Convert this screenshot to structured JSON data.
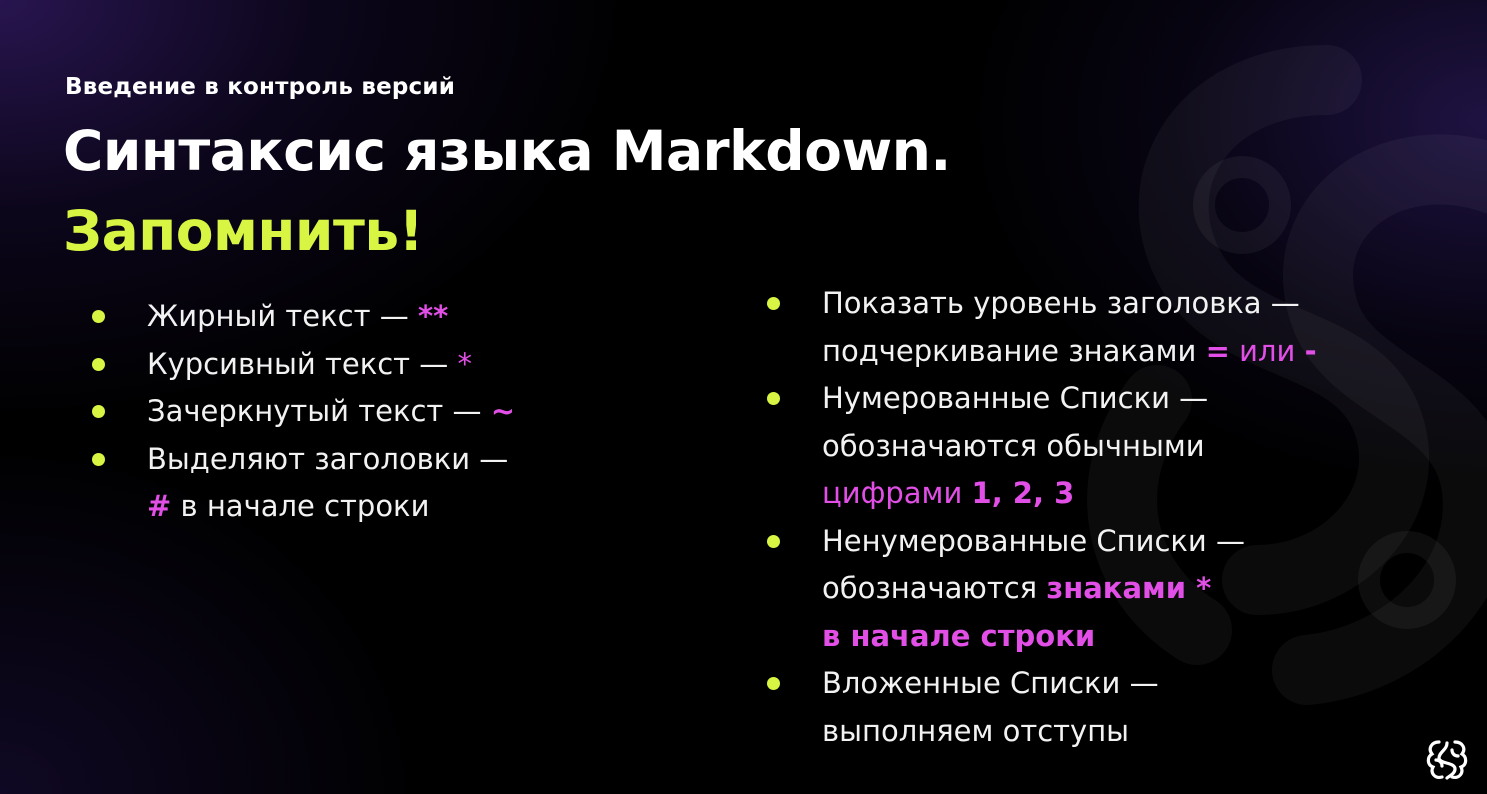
{
  "header": {
    "subtitle": "Введение в контроль версий",
    "title_main": "Синтаксис языка Markdown.",
    "title_accent": "Запомнить!"
  },
  "left_list": [
    {
      "text": "Жирный текст — ",
      "marker": "**"
    },
    {
      "text": "Курсивный текст — ",
      "marker": "*"
    },
    {
      "text": "Зачеркнутый текст — ",
      "marker": "~"
    },
    {
      "line1": "Выделяют заголовки —",
      "marker": "#",
      "line2": " в начале строки"
    }
  ],
  "right_list": [
    {
      "line1": "Показать уровень заголовка —",
      "line2": "подчеркивание знаками ",
      "marker1": "=",
      "sep": " или ",
      "marker2": "-"
    },
    {
      "line1": "Нумерованные Списки —",
      "line2": "обозначаются обычными",
      "line3_word": "цифрами ",
      "line3_digits": "1, 2, 3"
    },
    {
      "line1": "Ненумерованные Списки —",
      "line2": "обозначаются ",
      "line2_accent": "знаками *",
      "line3": "в начале строки"
    },
    {
      "line1": "Вложенные Списки —",
      "line2": "выполняем отступы"
    }
  ],
  "colors": {
    "accent_lime": "#d7f542",
    "accent_magenta": "#e14fe6",
    "text": "#f2f2f2",
    "background": "#000000"
  },
  "icons": [
    "bullet-dot",
    "brain-logo"
  ]
}
